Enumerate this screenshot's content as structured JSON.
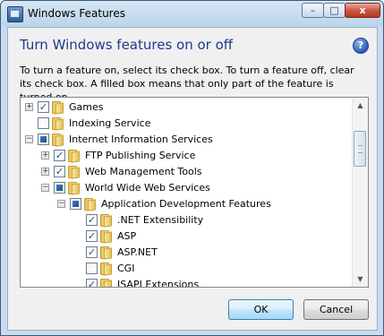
{
  "window": {
    "title": "Windows Features",
    "minimize": "–",
    "maximize": "□",
    "close": "x"
  },
  "heading": "Turn Windows features on or off",
  "description": "To turn a feature on, select its check box. To turn a feature off, clear its check box. A filled box means that only part of the feature is turned on.",
  "help_glyph": "?",
  "features": [
    {
      "label": "Games",
      "level": 0,
      "expander": "+",
      "state": "checked"
    },
    {
      "label": "Indexing Service",
      "level": 0,
      "expander": "",
      "state": "unchecked"
    },
    {
      "label": "Internet Information Services",
      "level": 0,
      "expander": "−",
      "state": "partial"
    },
    {
      "label": "FTP Publishing Service",
      "level": 1,
      "expander": "+",
      "state": "checked"
    },
    {
      "label": "Web Management Tools",
      "level": 1,
      "expander": "+",
      "state": "checked"
    },
    {
      "label": "World Wide Web Services",
      "level": 1,
      "expander": "−",
      "state": "partial"
    },
    {
      "label": "Application Development Features",
      "level": 2,
      "expander": "−",
      "state": "partial"
    },
    {
      "label": ".NET Extensibility",
      "level": 3,
      "expander": "",
      "state": "checked"
    },
    {
      "label": "ASP",
      "level": 3,
      "expander": "",
      "state": "checked"
    },
    {
      "label": "ASP.NET",
      "level": 3,
      "expander": "",
      "state": "checked"
    },
    {
      "label": "CGI",
      "level": 3,
      "expander": "",
      "state": "unchecked"
    },
    {
      "label": "ISAPI Extensions",
      "level": 3,
      "expander": "",
      "state": "checked"
    }
  ],
  "buttons": {
    "ok": "OK",
    "cancel": "Cancel"
  },
  "colors": {
    "heading": "#1e3a8a",
    "checkmark": "#1a4f8a",
    "partial_fill": "#2a66ab"
  }
}
